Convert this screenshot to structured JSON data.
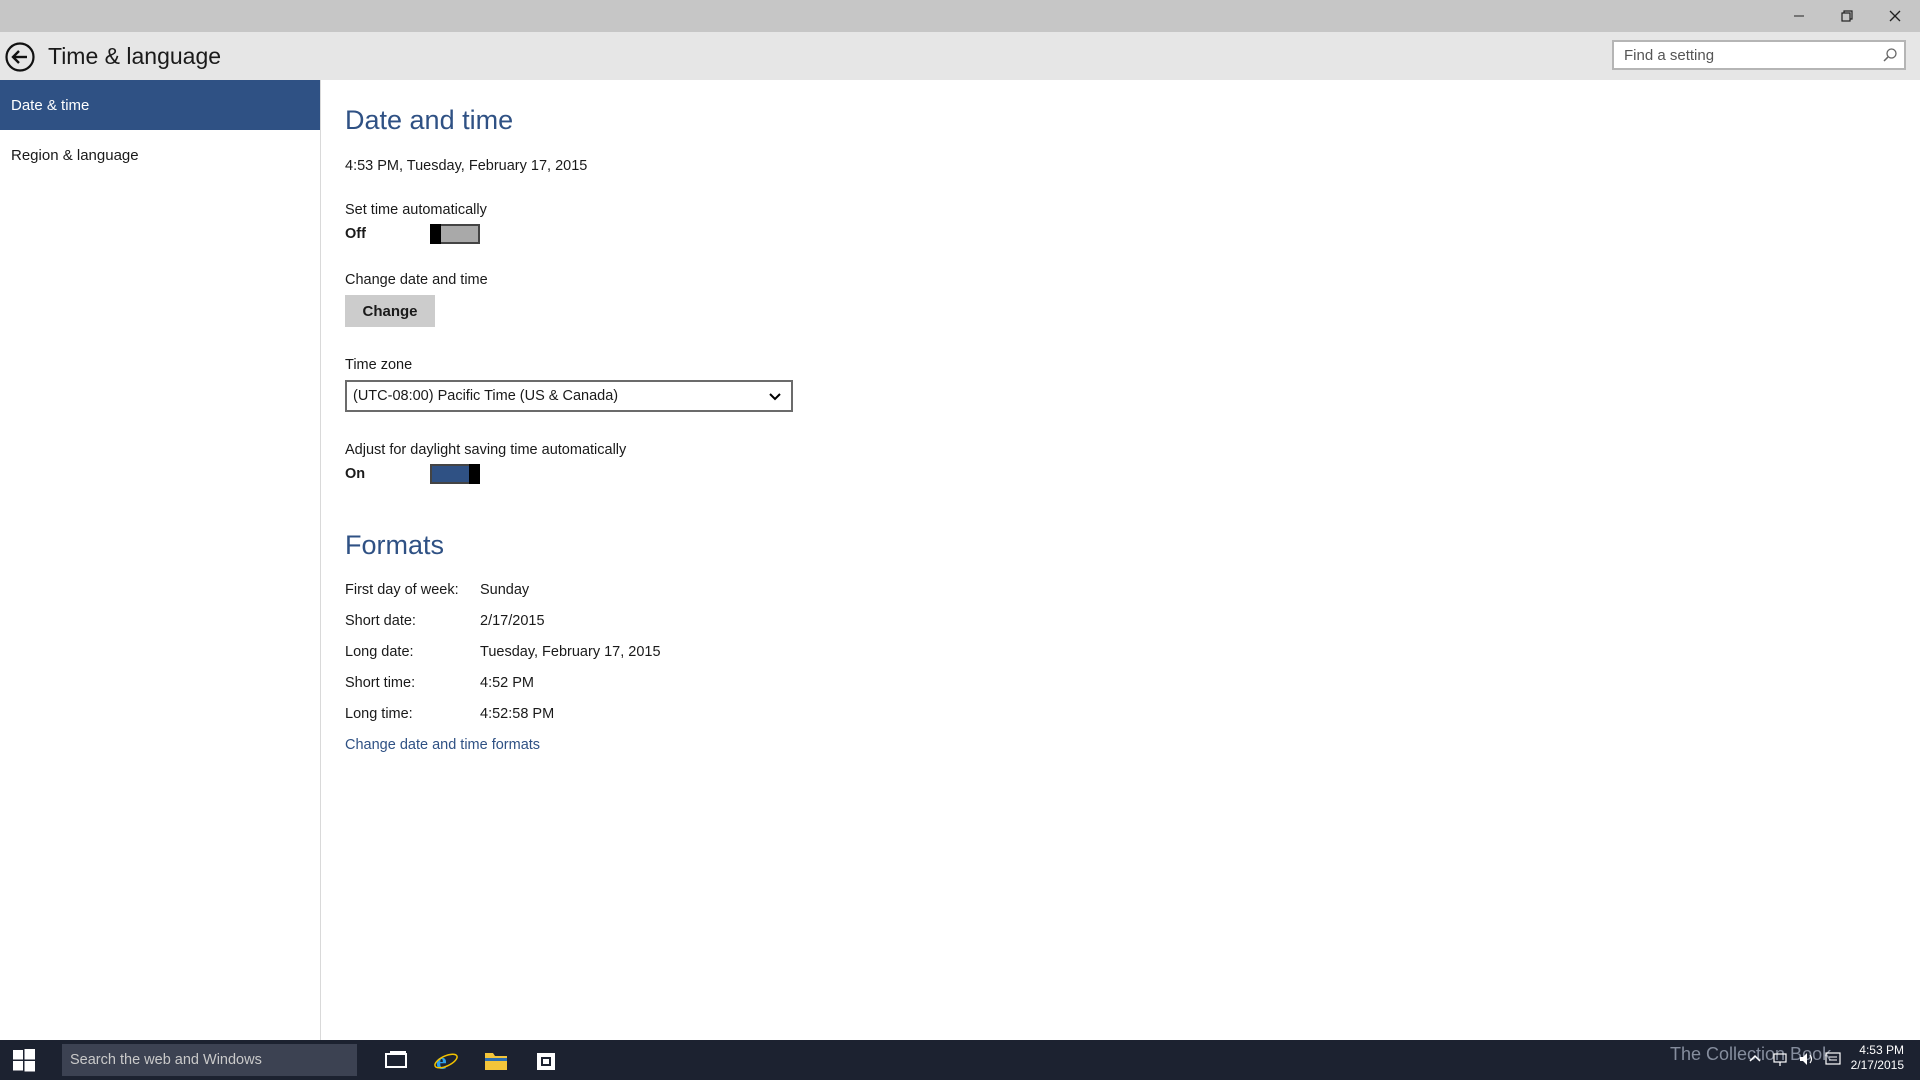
{
  "window": {
    "title": "Time & language",
    "controls": [
      "minimize-icon",
      "restore-icon",
      "close-icon"
    ]
  },
  "search": {
    "placeholder": "Find a setting",
    "icon": "search-icon"
  },
  "sidebar": {
    "items": [
      {
        "label": "Date & time",
        "active": true
      },
      {
        "label": "Region & language",
        "active": false
      }
    ]
  },
  "date_time": {
    "heading": "Date and time",
    "current": "4:53 PM, Tuesday, February 17, 2015",
    "set_auto": {
      "label": "Set time automatically",
      "state": "Off",
      "on": false
    },
    "change": {
      "label": "Change date and time",
      "button": "Change"
    },
    "time_zone": {
      "label": "Time zone",
      "value": "(UTC-08:00) Pacific Time (US & Canada)"
    },
    "dst": {
      "label": "Adjust for daylight saving time automatically",
      "state": "On",
      "on": true
    }
  },
  "formats": {
    "heading": "Formats",
    "rows": [
      {
        "key": "First day of week:",
        "value": "Sunday"
      },
      {
        "key": "Short date:",
        "value": "2/17/2015"
      },
      {
        "key": "Long date:",
        "value": "Tuesday, February 17, 2015"
      },
      {
        "key": "Short time:",
        "value": "4:52 PM"
      },
      {
        "key": "Long time:",
        "value": "4:52:58 PM"
      }
    ],
    "link": "Change date and time formats"
  },
  "taskbar": {
    "search_placeholder": "Search the web and Windows",
    "pinned": [
      "task-view-icon",
      "internet-explorer-icon",
      "file-explorer-icon",
      "store-icon"
    ],
    "watermark": "The Collection Book",
    "clock_time": "4:53 PM",
    "clock_date": "2/17/2015"
  },
  "colors": {
    "accent": "#2f5184",
    "titlebar": "#c6c6c6",
    "header": "#e6e6e6",
    "taskbar": "#1c2230"
  }
}
